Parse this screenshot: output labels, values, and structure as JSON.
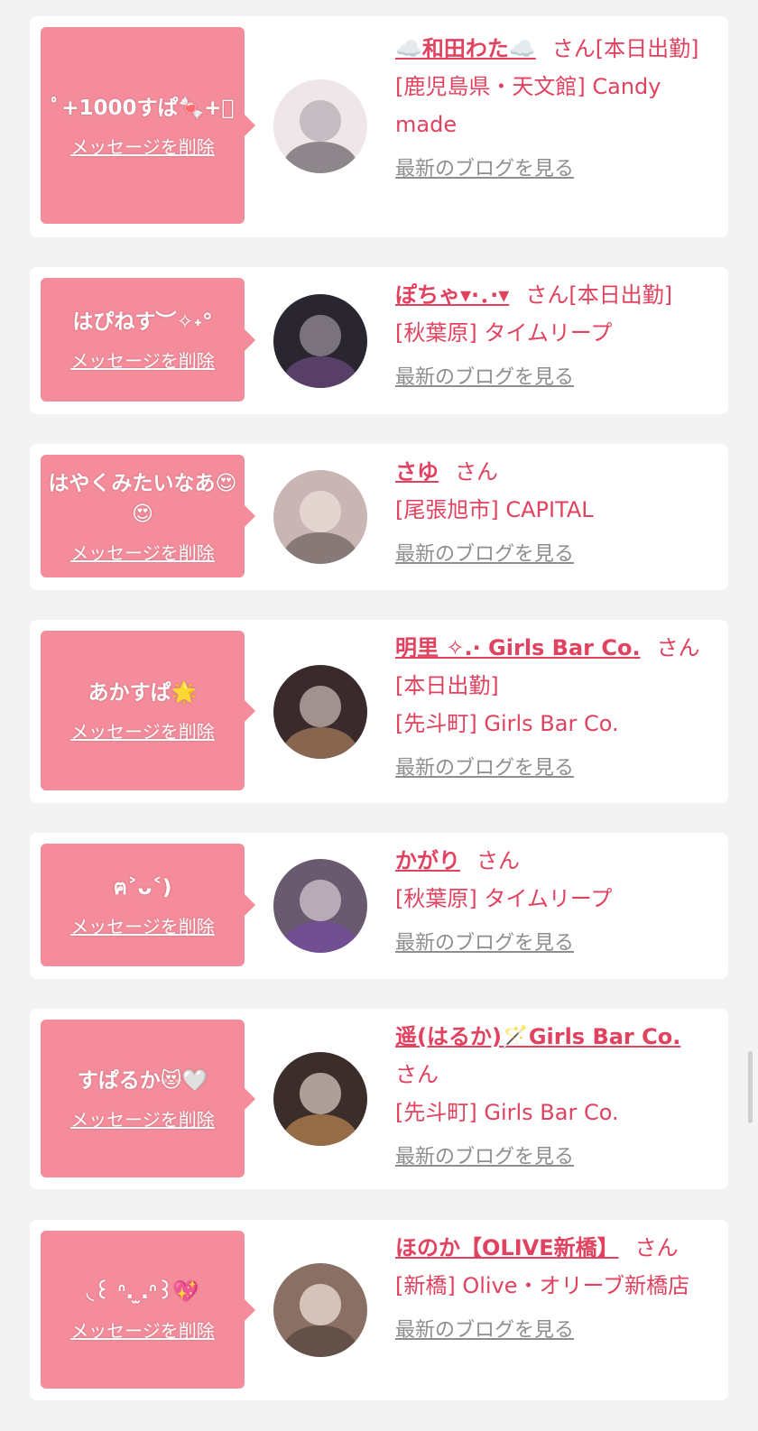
{
  "entries": [
    {
      "message": "ﾟ+1000すぱ🍬+ﾟ",
      "delete_label": "メッセージを削除",
      "name": "☁️和田わた☁️",
      "honorific": "さん",
      "status": "[本日出勤]",
      "store": "[鹿児島県・天文館] Candy made",
      "blog_label": "最新のブログを見る",
      "avatar_color": "#efe6ea"
    },
    {
      "message": "はぴねす︶✧˖°",
      "delete_label": "メッセージを削除",
      "name": "ぽちゃ▾·．·▾",
      "honorific": "さん",
      "status": "[本日出勤]",
      "store": "[秋葉原] タイムリープ",
      "blog_label": "最新のブログを見る",
      "avatar_color": "#2a2630"
    },
    {
      "message": "はやくみたいなあ😍😍",
      "delete_label": "メッセージを削除",
      "name": "さゆ",
      "honorific": "さん",
      "status": "",
      "store": "[尾張旭市] CAPITAL",
      "blog_label": "最新のブログを見る",
      "avatar_color": "#c9b6b4"
    },
    {
      "message": "あかすぱ🌟",
      "delete_label": "メッセージを削除",
      "name": "明里 ✧.· Girls Bar Co.",
      "honorific": "さん",
      "status": "[本日出勤]",
      "store": "[先斗町] Girls Bar Co.",
      "blog_label": "最新のブログを見る",
      "avatar_color": "#3a2a2c"
    },
    {
      "message": "ฅ˃ᴗ˂)",
      "delete_label": "メッセージを削除",
      "name": "かがり",
      "honorific": "さん",
      "status": "",
      "store": "[秋葉原] タイムリープ",
      "blog_label": "最新のブログを見る",
      "avatar_color": "#6a5a70"
    },
    {
      "message": "すぱるか😻🤍",
      "delete_label": "メッセージを削除",
      "name": "遥(はるか)🪄Girls Bar Co.",
      "honorific": "さん",
      "status": "",
      "store": "[先斗町] Girls Bar Co.",
      "blog_label": "最新のブログを見る",
      "avatar_color": "#3b2e2a"
    },
    {
      "message": "◟꒰ ᐢ. ̫.ᐢ꒱💖",
      "delete_label": "メッセージを削除",
      "name": "ほのか【OLIVE新橋】",
      "honorific": "さん",
      "status": "",
      "store": "[新橋] Olive・オリーブ新橋店",
      "blog_label": "最新のブログを見る",
      "avatar_color": "#8a7064"
    }
  ],
  "colors": {
    "accent": "#e0425f",
    "bubble": "#f48c9b",
    "muted": "#8e8e8e",
    "background": "#f3f3f3"
  }
}
